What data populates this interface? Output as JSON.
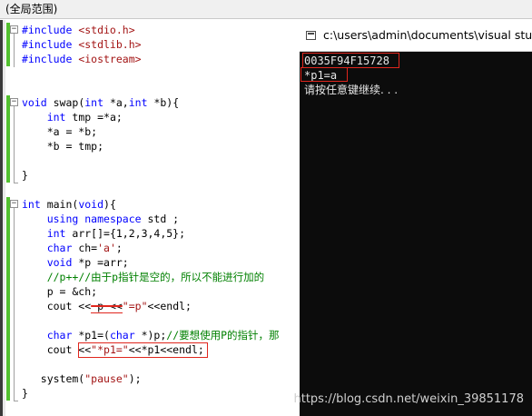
{
  "scope_bar": {
    "label": "(全局范围)"
  },
  "editor": {
    "lines": [
      [
        {
          "t": "#include ",
          "c": "kw"
        },
        {
          "t": "<stdio.h>",
          "c": "str"
        }
      ],
      [
        {
          "t": "#include ",
          "c": "kw"
        },
        {
          "t": "<stdlib.h>",
          "c": "str"
        }
      ],
      [
        {
          "t": "#include ",
          "c": "kw"
        },
        {
          "t": "<iostream>",
          "c": "str"
        }
      ],
      [],
      [],
      [
        {
          "t": "void",
          "c": "kw"
        },
        {
          "t": " swap("
        },
        {
          "t": "int",
          "c": "kw"
        },
        {
          "t": " *a,"
        },
        {
          "t": "int",
          "c": "kw"
        },
        {
          "t": " *b){"
        }
      ],
      [
        {
          "t": "    "
        },
        {
          "t": "int",
          "c": "kw"
        },
        {
          "t": " tmp =*a;"
        }
      ],
      [
        {
          "t": "    *a = *b;"
        }
      ],
      [
        {
          "t": "    *b = tmp;"
        }
      ],
      [],
      [
        {
          "t": "}"
        }
      ],
      [],
      [
        {
          "t": "int",
          "c": "kw"
        },
        {
          "t": " main("
        },
        {
          "t": "void",
          "c": "kw"
        },
        {
          "t": "){"
        }
      ],
      [
        {
          "t": "    "
        },
        {
          "t": "using namespace",
          "c": "kw"
        },
        {
          "t": " std ;"
        }
      ],
      [
        {
          "t": "    "
        },
        {
          "t": "int",
          "c": "kw"
        },
        {
          "t": " arr[]={1,2,3,4,5};"
        }
      ],
      [
        {
          "t": "    "
        },
        {
          "t": "char",
          "c": "kw"
        },
        {
          "t": " ch="
        },
        {
          "t": "'a'",
          "c": "str"
        },
        {
          "t": ";"
        }
      ],
      [
        {
          "t": "    "
        },
        {
          "t": "void",
          "c": "kw"
        },
        {
          "t": " *p =arr;"
        }
      ],
      [
        {
          "t": "    "
        },
        {
          "t": "//p++//由于p指针是空的，所以不能进行加的",
          "c": "cmt"
        }
      ],
      [
        {
          "t": "    p = &ch;"
        }
      ],
      [
        {
          "t": "    cout <<"
        },
        {
          "t": " p <<",
          "c": "strike"
        },
        {
          "t": "\"=p\"",
          "c": "str"
        },
        {
          "t": "<<endl;"
        }
      ],
      [],
      [
        {
          "t": "    "
        },
        {
          "t": "char",
          "c": "kw"
        },
        {
          "t": " *p1=("
        },
        {
          "t": "char",
          "c": "kw"
        },
        {
          "t": " *)p;"
        },
        {
          "t": "//要想使用P的指针，那",
          "c": "cmt"
        }
      ],
      [
        {
          "t": "    cout <<"
        },
        {
          "t": "\"*p1=\"",
          "c": "str"
        },
        {
          "t": "<<*p1<<endl;"
        }
      ],
      [],
      [
        {
          "t": "   system("
        },
        {
          "t": "\"pause\"",
          "c": "str"
        },
        {
          "t": ");"
        }
      ],
      [
        {
          "t": "}"
        }
      ]
    ]
  },
  "console": {
    "title": "c:\\users\\admin\\documents\\visual studio",
    "output": [
      "0035F94F15728",
      "*p1=a",
      "请按任意键继续. . ."
    ]
  },
  "watermark": "https://blog.csdn.net/weixin_39851178"
}
